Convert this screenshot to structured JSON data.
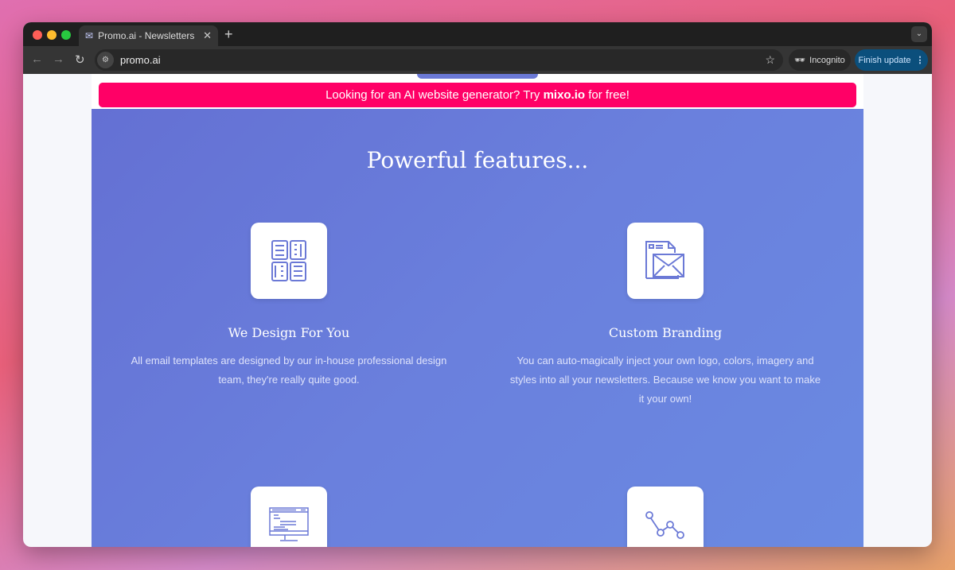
{
  "browser": {
    "tab_title": "Promo.ai - Newsletters made",
    "url": "promo.ai",
    "incognito_label": "Incognito",
    "finish_update_label": "Finish update"
  },
  "banner": {
    "prefix": "Looking for an AI website generator? Try ",
    "link": "mixo.io",
    "suffix": " for free!",
    "color": "#ff0066"
  },
  "features": {
    "title": "Powerful features...",
    "items": [
      {
        "icon": "layout-grid-icon",
        "heading": "We Design For You",
        "text": "All email templates are designed by our in-house professional design team, they're really quite good."
      },
      {
        "icon": "envelope-document-icon",
        "heading": "Custom Branding",
        "text": "You can auto-magically inject your own logo, colors, imagery and styles into all your newsletters. Because we know you want to make it your own!"
      },
      {
        "icon": "monitor-code-icon"
      },
      {
        "icon": "line-chart-icon"
      }
    ],
    "accent": "#6b79d6"
  }
}
